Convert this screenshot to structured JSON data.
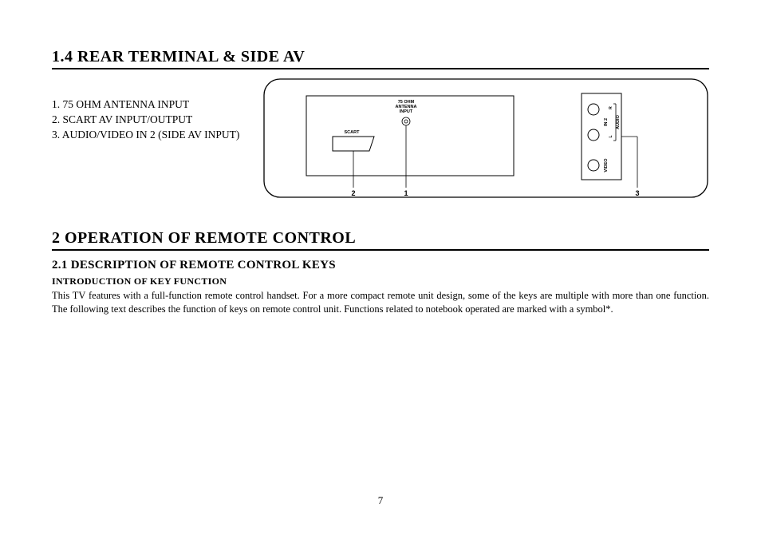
{
  "section1": {
    "heading": "1.4 REAR TERMINAL & SIDE AV",
    "items": [
      "1.  75 OHM ANTENNA INPUT",
      "2.  SCART AV INPUT/OUTPUT",
      "3.  AUDIO/VIDEO IN 2 (SIDE AV INPUT)"
    ]
  },
  "diagram": {
    "antenna_label1": "75 OHM",
    "antenna_label2": "ANTENNA",
    "antenna_label3": "INPUT",
    "scart_label": "SCART",
    "callout1": "1",
    "callout2": "2",
    "callout3": "3",
    "side_in2": "IN 2",
    "side_audio": "AUDIO",
    "side_r": "R",
    "side_l": "L",
    "side_video": "VIDEO"
  },
  "section2": {
    "heading": "2 OPERATION OF REMOTE CONTROL",
    "subheading": "2.1 DESCRIPTION OF REMOTE CONTROL KEYS",
    "subsub": "INTRODUCTION OF KEY FUNCTION",
    "body": "This TV features with a full-function remote control handset. For a more compact remote unit design, some of the keys are multiple with more than one function. The following text describes the function of keys on remote control unit. Functions related to notebook operated are marked with a symbol*."
  },
  "page_number": "7"
}
